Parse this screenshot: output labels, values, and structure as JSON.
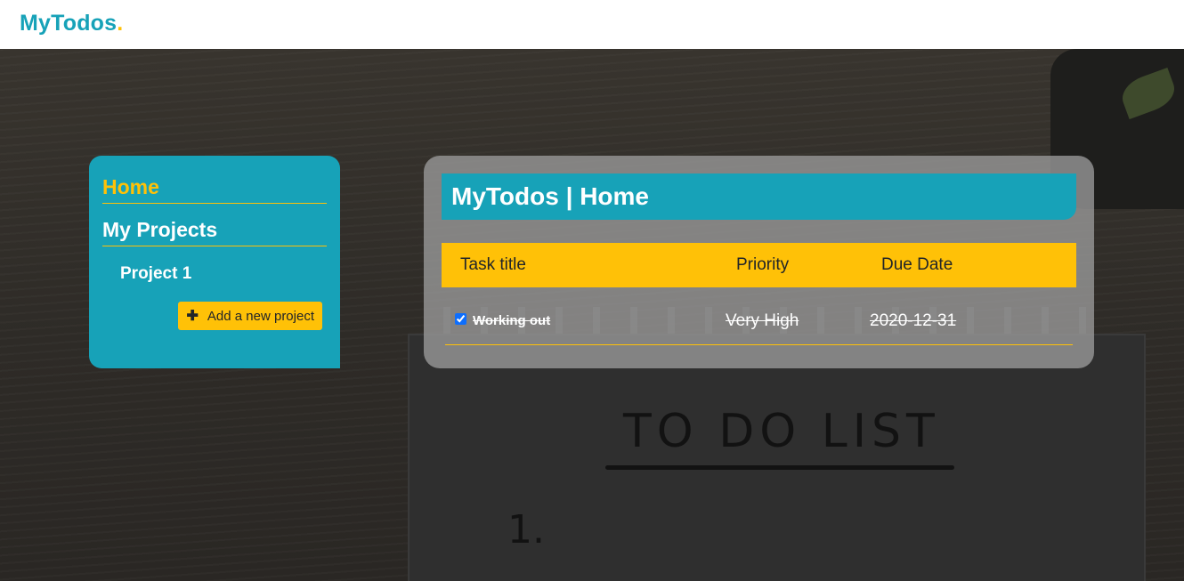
{
  "navbar": {
    "brand": "MyTodos",
    "brand_dot": "."
  },
  "background": {
    "paper_title": "TO DO LIST",
    "paper_number": "1."
  },
  "sidebar": {
    "home_label": "Home",
    "projects_label": "My Projects",
    "projects": [
      {
        "label": "Project 1"
      }
    ],
    "add_project_label": "Add a new project",
    "add_project_icon": "plus-icon"
  },
  "main": {
    "title": "MyTodos | Home",
    "columns": {
      "title": "Task title",
      "priority": "Priority",
      "due_date": "Due Date"
    },
    "tasks": [
      {
        "title": "Working out",
        "priority": "Very High",
        "due_date": "2020-12-31",
        "completed": true
      }
    ]
  },
  "colors": {
    "primary": "#17a2b8",
    "accent": "#ffc107",
    "navbar_bg": "#ffffff"
  }
}
